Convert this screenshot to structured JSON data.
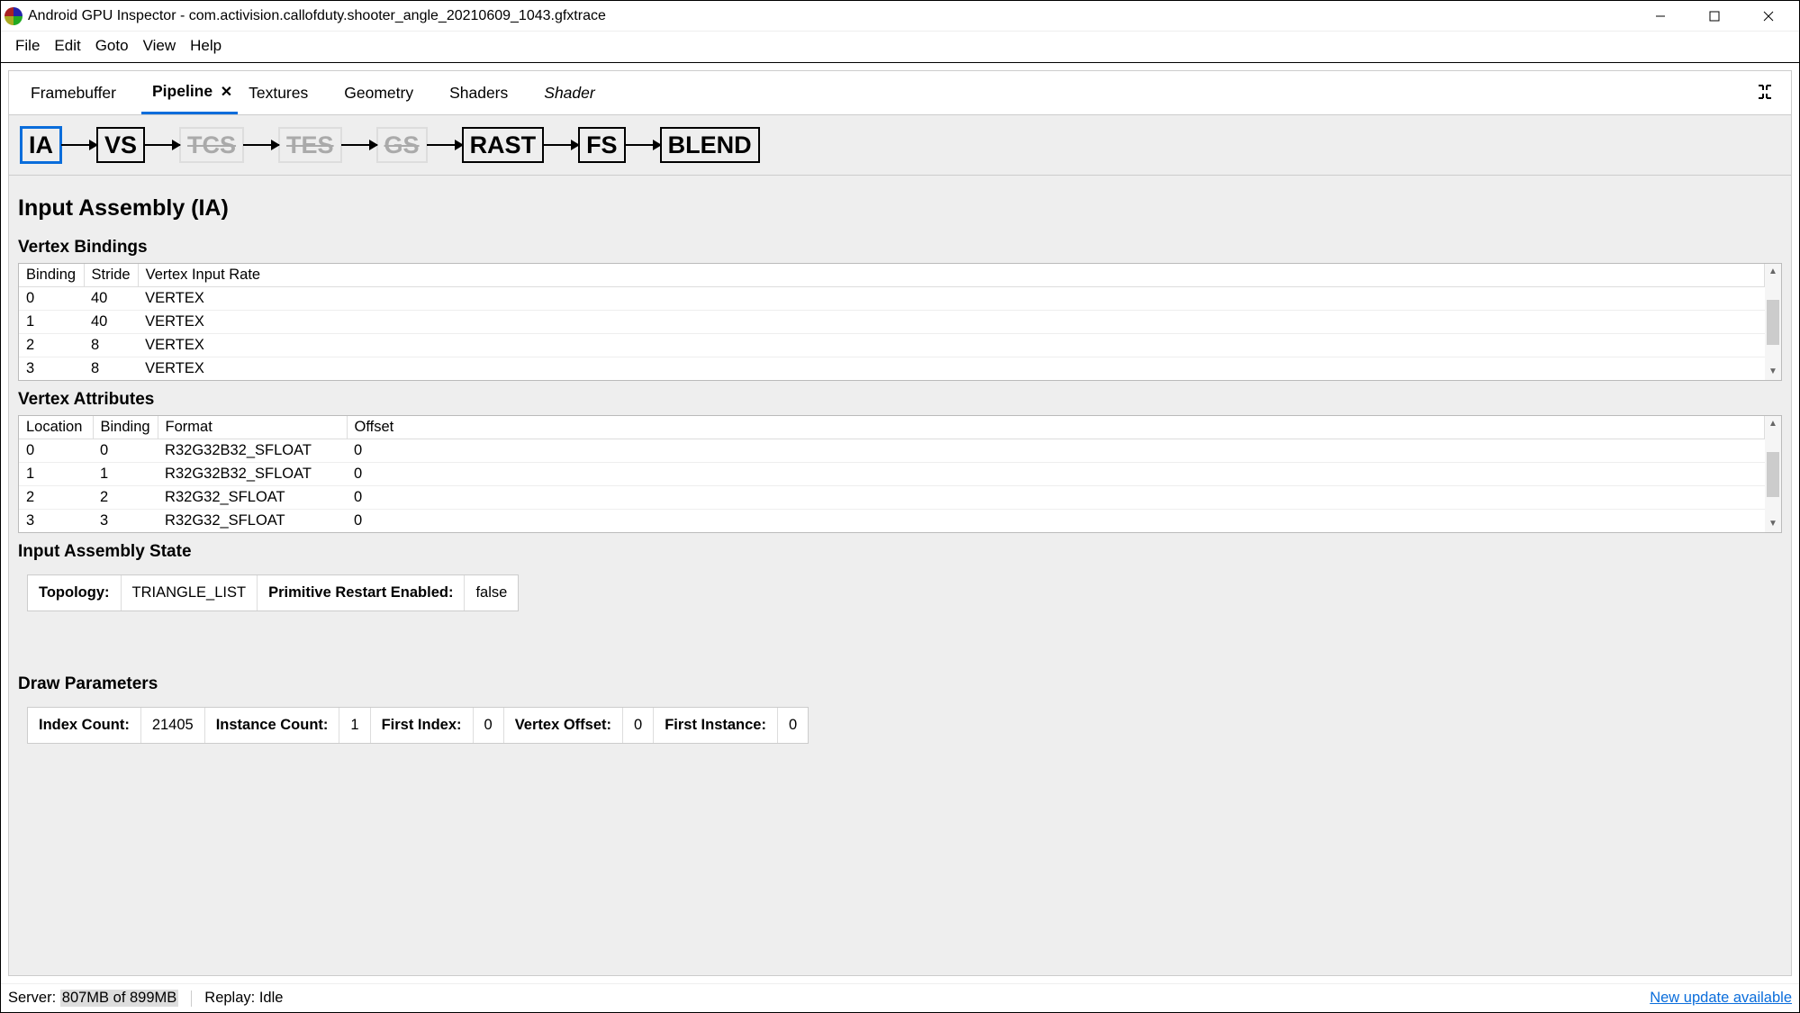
{
  "window": {
    "title": "Android GPU Inspector - com.activision.callofduty.shooter_angle_20210609_1043.gfxtrace"
  },
  "menu": [
    "File",
    "Edit",
    "Goto",
    "View",
    "Help"
  ],
  "tabs": [
    {
      "label": "Framebuffer",
      "active": false,
      "closable": false
    },
    {
      "label": "Pipeline",
      "active": true,
      "closable": true
    },
    {
      "label": "Textures",
      "active": false,
      "closable": false
    },
    {
      "label": "Geometry",
      "active": false,
      "closable": false
    },
    {
      "label": "Shaders",
      "active": false,
      "closable": false
    },
    {
      "label": "Shader",
      "active": false,
      "closable": false,
      "italic": true
    }
  ],
  "pipeline_stages": [
    {
      "name": "IA",
      "enabled": true,
      "selected": true
    },
    {
      "name": "VS",
      "enabled": true,
      "selected": false
    },
    {
      "name": "TCS",
      "enabled": false,
      "selected": false
    },
    {
      "name": "TES",
      "enabled": false,
      "selected": false
    },
    {
      "name": "GS",
      "enabled": false,
      "selected": false
    },
    {
      "name": "RAST",
      "enabled": true,
      "selected": false
    },
    {
      "name": "FS",
      "enabled": true,
      "selected": false
    },
    {
      "name": "BLEND",
      "enabled": true,
      "selected": false
    }
  ],
  "section_title": "Input Assembly (IA)",
  "vertex_bindings": {
    "heading": "Vertex Bindings",
    "columns": [
      "Binding",
      "Stride",
      "Vertex Input Rate"
    ],
    "rows": [
      {
        "binding": "0",
        "stride": "40",
        "rate": "VERTEX"
      },
      {
        "binding": "1",
        "stride": "40",
        "rate": "VERTEX"
      },
      {
        "binding": "2",
        "stride": "8",
        "rate": "VERTEX"
      },
      {
        "binding": "3",
        "stride": "8",
        "rate": "VERTEX"
      }
    ]
  },
  "vertex_attributes": {
    "heading": "Vertex Attributes",
    "columns": [
      "Location",
      "Binding",
      "Format",
      "Offset"
    ],
    "rows": [
      {
        "location": "0",
        "binding": "0",
        "format": "R32G32B32_SFLOAT",
        "offset": "0"
      },
      {
        "location": "1",
        "binding": "1",
        "format": "R32G32B32_SFLOAT",
        "offset": "0"
      },
      {
        "location": "2",
        "binding": "2",
        "format": "R32G32_SFLOAT",
        "offset": "0"
      },
      {
        "location": "3",
        "binding": "3",
        "format": "R32G32_SFLOAT",
        "offset": "0"
      }
    ]
  },
  "input_assembly_state": {
    "heading": "Input Assembly State",
    "topology_label": "Topology:",
    "topology_value": "TRIANGLE_LIST",
    "restart_label": "Primitive Restart Enabled:",
    "restart_value": "false"
  },
  "draw_parameters": {
    "heading": "Draw Parameters",
    "index_count_label": "Index Count:",
    "index_count_value": "21405",
    "instance_count_label": "Instance Count:",
    "instance_count_value": "1",
    "first_index_label": "First Index:",
    "first_index_value": "0",
    "vertex_offset_label": "Vertex Offset:",
    "vertex_offset_value": "0",
    "first_instance_label": "First Instance:",
    "first_instance_value": "0"
  },
  "status": {
    "server_label": "Server:",
    "server_mem": "807MB of 899MB",
    "replay_label": "Replay:",
    "replay_value": "Idle",
    "update_link": "New update available"
  }
}
